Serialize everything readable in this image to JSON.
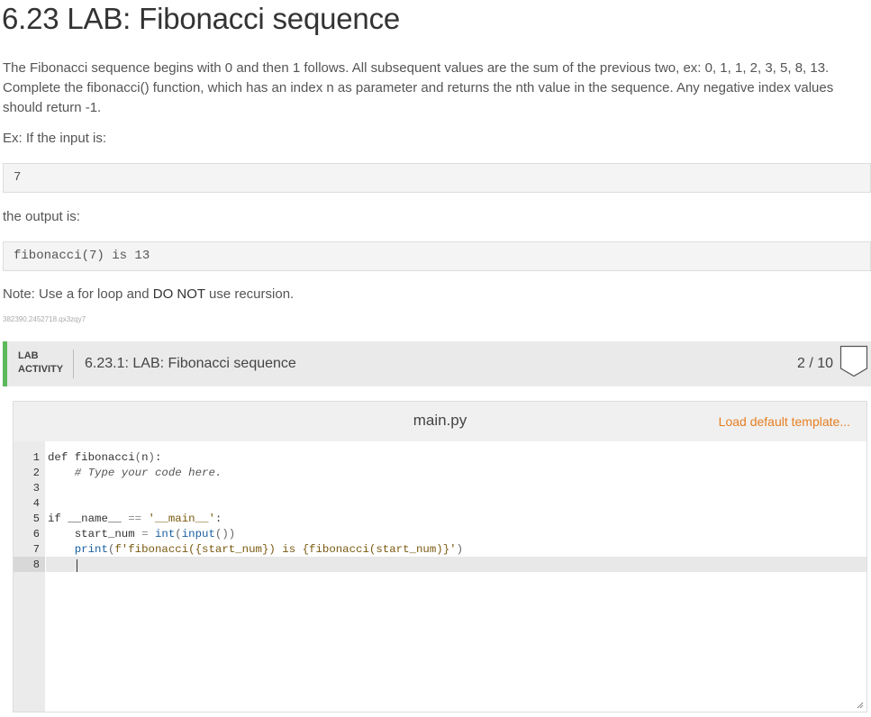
{
  "page": {
    "title": "6.23 LAB: Fibonacci sequence",
    "description": "The Fibonacci sequence begins with 0 and then 1 follows. All subsequent values are the sum of the previous two, ex: 0, 1, 1, 2, 3, 5, 8, 13. Complete the fibonacci() function, which has an index n as parameter and returns the nth value in the sequence. Any negative index values should return -1.",
    "example_label": "Ex: If the input is:",
    "example_input": "7",
    "output_label": "the output is:",
    "example_output": "fibonacci(7) is 13",
    "note_prefix": "Note: Use a for loop and ",
    "note_emphasis": "DO NOT",
    "note_suffix": " use recursion.",
    "content_id": "382390.2452718.qx3zqy7"
  },
  "lab": {
    "label_line1": "LAB",
    "label_line2": "ACTIVITY",
    "name": "6.23.1: LAB: Fibonacci sequence",
    "score": "2 / 10",
    "accent_color": "#5cb85c"
  },
  "editor": {
    "file_name": "main.py",
    "load_template_label": "Load default template...",
    "load_template_color": "#e67e22",
    "line_numbers": [
      "1",
      "2",
      "3",
      "4",
      "5",
      "6",
      "7",
      "8"
    ],
    "code_lines": [
      "def fibonacci(n):",
      "    # Type your code here.",
      "",
      "",
      "if __name__ == '__main__':",
      "    start_num = int(input())",
      "    print(f'fibonacci({start_num}) is {fibonacci(start_num)}')",
      ""
    ],
    "active_line": "8"
  },
  "icons": {
    "badge": "shield-badge-icon",
    "resize": "resize-grip-icon"
  }
}
